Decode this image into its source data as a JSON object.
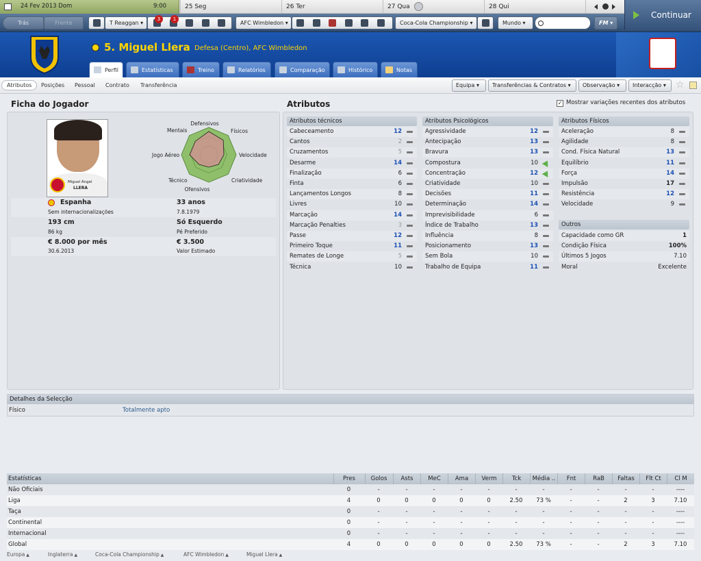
{
  "calendar": {
    "current_date": "24 Fev 2013 Dom",
    "time": "9:00",
    "days": [
      "25 Seg",
      "26 Ter",
      "27 Qua",
      "28 Qui"
    ]
  },
  "toolbar": {
    "back": "Trás",
    "forward": "Frente",
    "manager": "T Reaggan",
    "club": "AFC Wimbledon",
    "competition": "Coca-Cola Championship",
    "world": "Mundo",
    "fm": "FM",
    "continue": "Continuar",
    "badge1": "3",
    "badge2": "1"
  },
  "player": {
    "number_name": "5. Miguel Llera",
    "position_club": "Defesa (Centro), AFC Wimbledon",
    "photo_caption_first": "Miguel Ángel",
    "photo_caption_last": "LLERA"
  },
  "tabs": [
    "Perfil",
    "Estatísticas",
    "Treino",
    "Relatórios",
    "Comparação",
    "Histórico",
    "Notas"
  ],
  "subnav": [
    "Atributos",
    "Posições",
    "Pessoal",
    "Contrato",
    "Transferência"
  ],
  "actions": [
    "Equipa",
    "Transferências & Contratos",
    "Observação",
    "Interacção"
  ],
  "sections": {
    "ficha": "Ficha do Jogador",
    "atributos": "Atributos",
    "show_changes": "Mostrar variações recentes dos atributos"
  },
  "radar": {
    "labels": [
      "Defensivos",
      "Físicos",
      "Velocidade",
      "Criatividade",
      "Ofensivos",
      "Técnico",
      "Jogo Aéreo",
      "Mentais"
    ],
    "values": [
      0.85,
      0.75,
      0.55,
      0.5,
      0.45,
      0.5,
      0.7,
      0.7
    ]
  },
  "info": {
    "nation": "Espanha",
    "caps": "Sem internacionalizações",
    "age": "33 anos",
    "dob": "7.8.1979",
    "height": "193 cm",
    "weight": "86 kg",
    "foot": "Só Esquerdo",
    "foot_label": "Pé Preferido",
    "wage": "€ 8.000 por mês",
    "contract_end": "30.6.2013",
    "value": "€ 3.500",
    "value_label": "Valor Estimado"
  },
  "technical": {
    "title": "Atributos técnicos",
    "items": [
      {
        "name": "Cabeceamento",
        "value": "12",
        "style": "blue",
        "trend": "dash"
      },
      {
        "name": "Cantos",
        "value": "2",
        "style": "grey",
        "trend": "dash"
      },
      {
        "name": "Cruzamentos",
        "value": "5",
        "style": "grey",
        "trend": "dash"
      },
      {
        "name": "Desarme",
        "value": "14",
        "style": "blue",
        "trend": "dash"
      },
      {
        "name": "Finalização",
        "value": "6",
        "style": "normal",
        "trend": "dash"
      },
      {
        "name": "Finta",
        "value": "6",
        "style": "normal",
        "trend": "dash"
      },
      {
        "name": "Lançamentos Longos",
        "value": "8",
        "style": "normal",
        "trend": "dash"
      },
      {
        "name": "Livres",
        "value": "10",
        "style": "normal",
        "trend": "dash"
      },
      {
        "name": "Marcação",
        "value": "14",
        "style": "blue",
        "trend": "dash"
      },
      {
        "name": "Marcação Penalties",
        "value": "3",
        "style": "grey",
        "trend": "dash"
      },
      {
        "name": "Passe",
        "value": "12",
        "style": "blue",
        "trend": "dash"
      },
      {
        "name": "Primeiro Toque",
        "value": "11",
        "style": "blue",
        "trend": "dash"
      },
      {
        "name": "Remates de Longe",
        "value": "5",
        "style": "grey",
        "trend": "dash"
      },
      {
        "name": "Técnica",
        "value": "10",
        "style": "normal",
        "trend": "dash"
      }
    ]
  },
  "mental": {
    "title": "Atributos Psicológicos",
    "items": [
      {
        "name": "Agressividade",
        "value": "12",
        "style": "blue",
        "trend": "dash"
      },
      {
        "name": "Antecipação",
        "value": "13",
        "style": "blue",
        "trend": "dash"
      },
      {
        "name": "Bravura",
        "value": "13",
        "style": "blue",
        "trend": "dash"
      },
      {
        "name": "Compostura",
        "value": "10",
        "style": "normal",
        "trend": "up"
      },
      {
        "name": "Concentração",
        "value": "12",
        "style": "blue",
        "trend": "up"
      },
      {
        "name": "Criatividade",
        "value": "10",
        "style": "normal",
        "trend": "dash"
      },
      {
        "name": "Decisões",
        "value": "11",
        "style": "blue",
        "trend": "dash"
      },
      {
        "name": "Determinação",
        "value": "14",
        "style": "blue",
        "trend": "dash"
      },
      {
        "name": "Imprevisibilidade",
        "value": "6",
        "style": "normal",
        "trend": "dash"
      },
      {
        "name": "Índice de Trabalho",
        "value": "13",
        "style": "blue",
        "trend": "dash"
      },
      {
        "name": "Influência",
        "value": "8",
        "style": "normal",
        "trend": "dash"
      },
      {
        "name": "Posicionamento",
        "value": "13",
        "style": "blue",
        "trend": "dash"
      },
      {
        "name": "Sem Bola",
        "value": "10",
        "style": "normal",
        "trend": "dash"
      },
      {
        "name": "Trabalho de Equipa",
        "value": "11",
        "style": "blue",
        "trend": "dash"
      }
    ]
  },
  "physical": {
    "title": "Atributos Físicos",
    "items": [
      {
        "name": "Aceleração",
        "value": "8",
        "style": "normal",
        "trend": "dash"
      },
      {
        "name": "Agilidade",
        "value": "8",
        "style": "normal",
        "trend": "dash"
      },
      {
        "name": "Cond. Física Natural",
        "value": "13",
        "style": "blue",
        "trend": "dash"
      },
      {
        "name": "Equilíbrio",
        "value": "11",
        "style": "blue",
        "trend": "dash"
      },
      {
        "name": "Força",
        "value": "14",
        "style": "blue",
        "trend": "dash"
      },
      {
        "name": "Impulsão",
        "value": "17",
        "style": "dark",
        "trend": "dash"
      },
      {
        "name": "Resistência",
        "value": "12",
        "style": "blue",
        "trend": "dash"
      },
      {
        "name": "Velocidade",
        "value": "9",
        "style": "normal",
        "trend": "dash"
      }
    ]
  },
  "others": {
    "title": "Outros",
    "items": [
      {
        "name": "Capacidade como GR",
        "value": "1",
        "bold": true
      },
      {
        "name": "Condição Física",
        "value": "100%",
        "bold": true
      },
      {
        "name": "Últimos 5 Jogos",
        "value": "7.10",
        "bold": false
      },
      {
        "name": "Moral",
        "value": "Excelente",
        "bold": false
      }
    ]
  },
  "selection": {
    "title": "Detalhes da Selecção",
    "label": "Físico",
    "value": "Totalmente apto"
  },
  "stats": {
    "headers": [
      "Estatísticas",
      "Pres",
      "Golos",
      "Asts",
      "MeC",
      "Ama",
      "Verm",
      "Tck",
      "Média ..",
      "Fnt",
      "RaB",
      "Faltas",
      "Flt Ct",
      "Cl M"
    ],
    "rows": [
      [
        "Não Oficiais",
        "0",
        "-",
        "-",
        "-",
        "-",
        "-",
        "-",
        "-",
        "-",
        "-",
        "-",
        "-",
        "----"
      ],
      [
        "Liga",
        "4",
        "0",
        "0",
        "0",
        "0",
        "0",
        "2.50",
        "73 %",
        "-",
        "-",
        "2",
        "3",
        "7.10"
      ],
      [
        "Taça",
        "0",
        "-",
        "-",
        "-",
        "-",
        "-",
        "-",
        "-",
        "-",
        "-",
        "-",
        "-",
        "----"
      ],
      [
        "Continental",
        "0",
        "-",
        "-",
        "-",
        "-",
        "-",
        "-",
        "-",
        "-",
        "-",
        "-",
        "-",
        "----"
      ],
      [
        "Internacional",
        "0",
        "-",
        "-",
        "-",
        "-",
        "-",
        "-",
        "-",
        "-",
        "-",
        "-",
        "-",
        "----"
      ],
      [
        "Global",
        "4",
        "0",
        "0",
        "0",
        "0",
        "0",
        "2.50",
        "73 %",
        "-",
        "-",
        "2",
        "3",
        "7.10"
      ]
    ]
  },
  "breadcrumb": [
    "Europa",
    "Inglaterra",
    "Coca-Cola Championship",
    "AFC Wimbledon",
    "Miguel Llera"
  ]
}
